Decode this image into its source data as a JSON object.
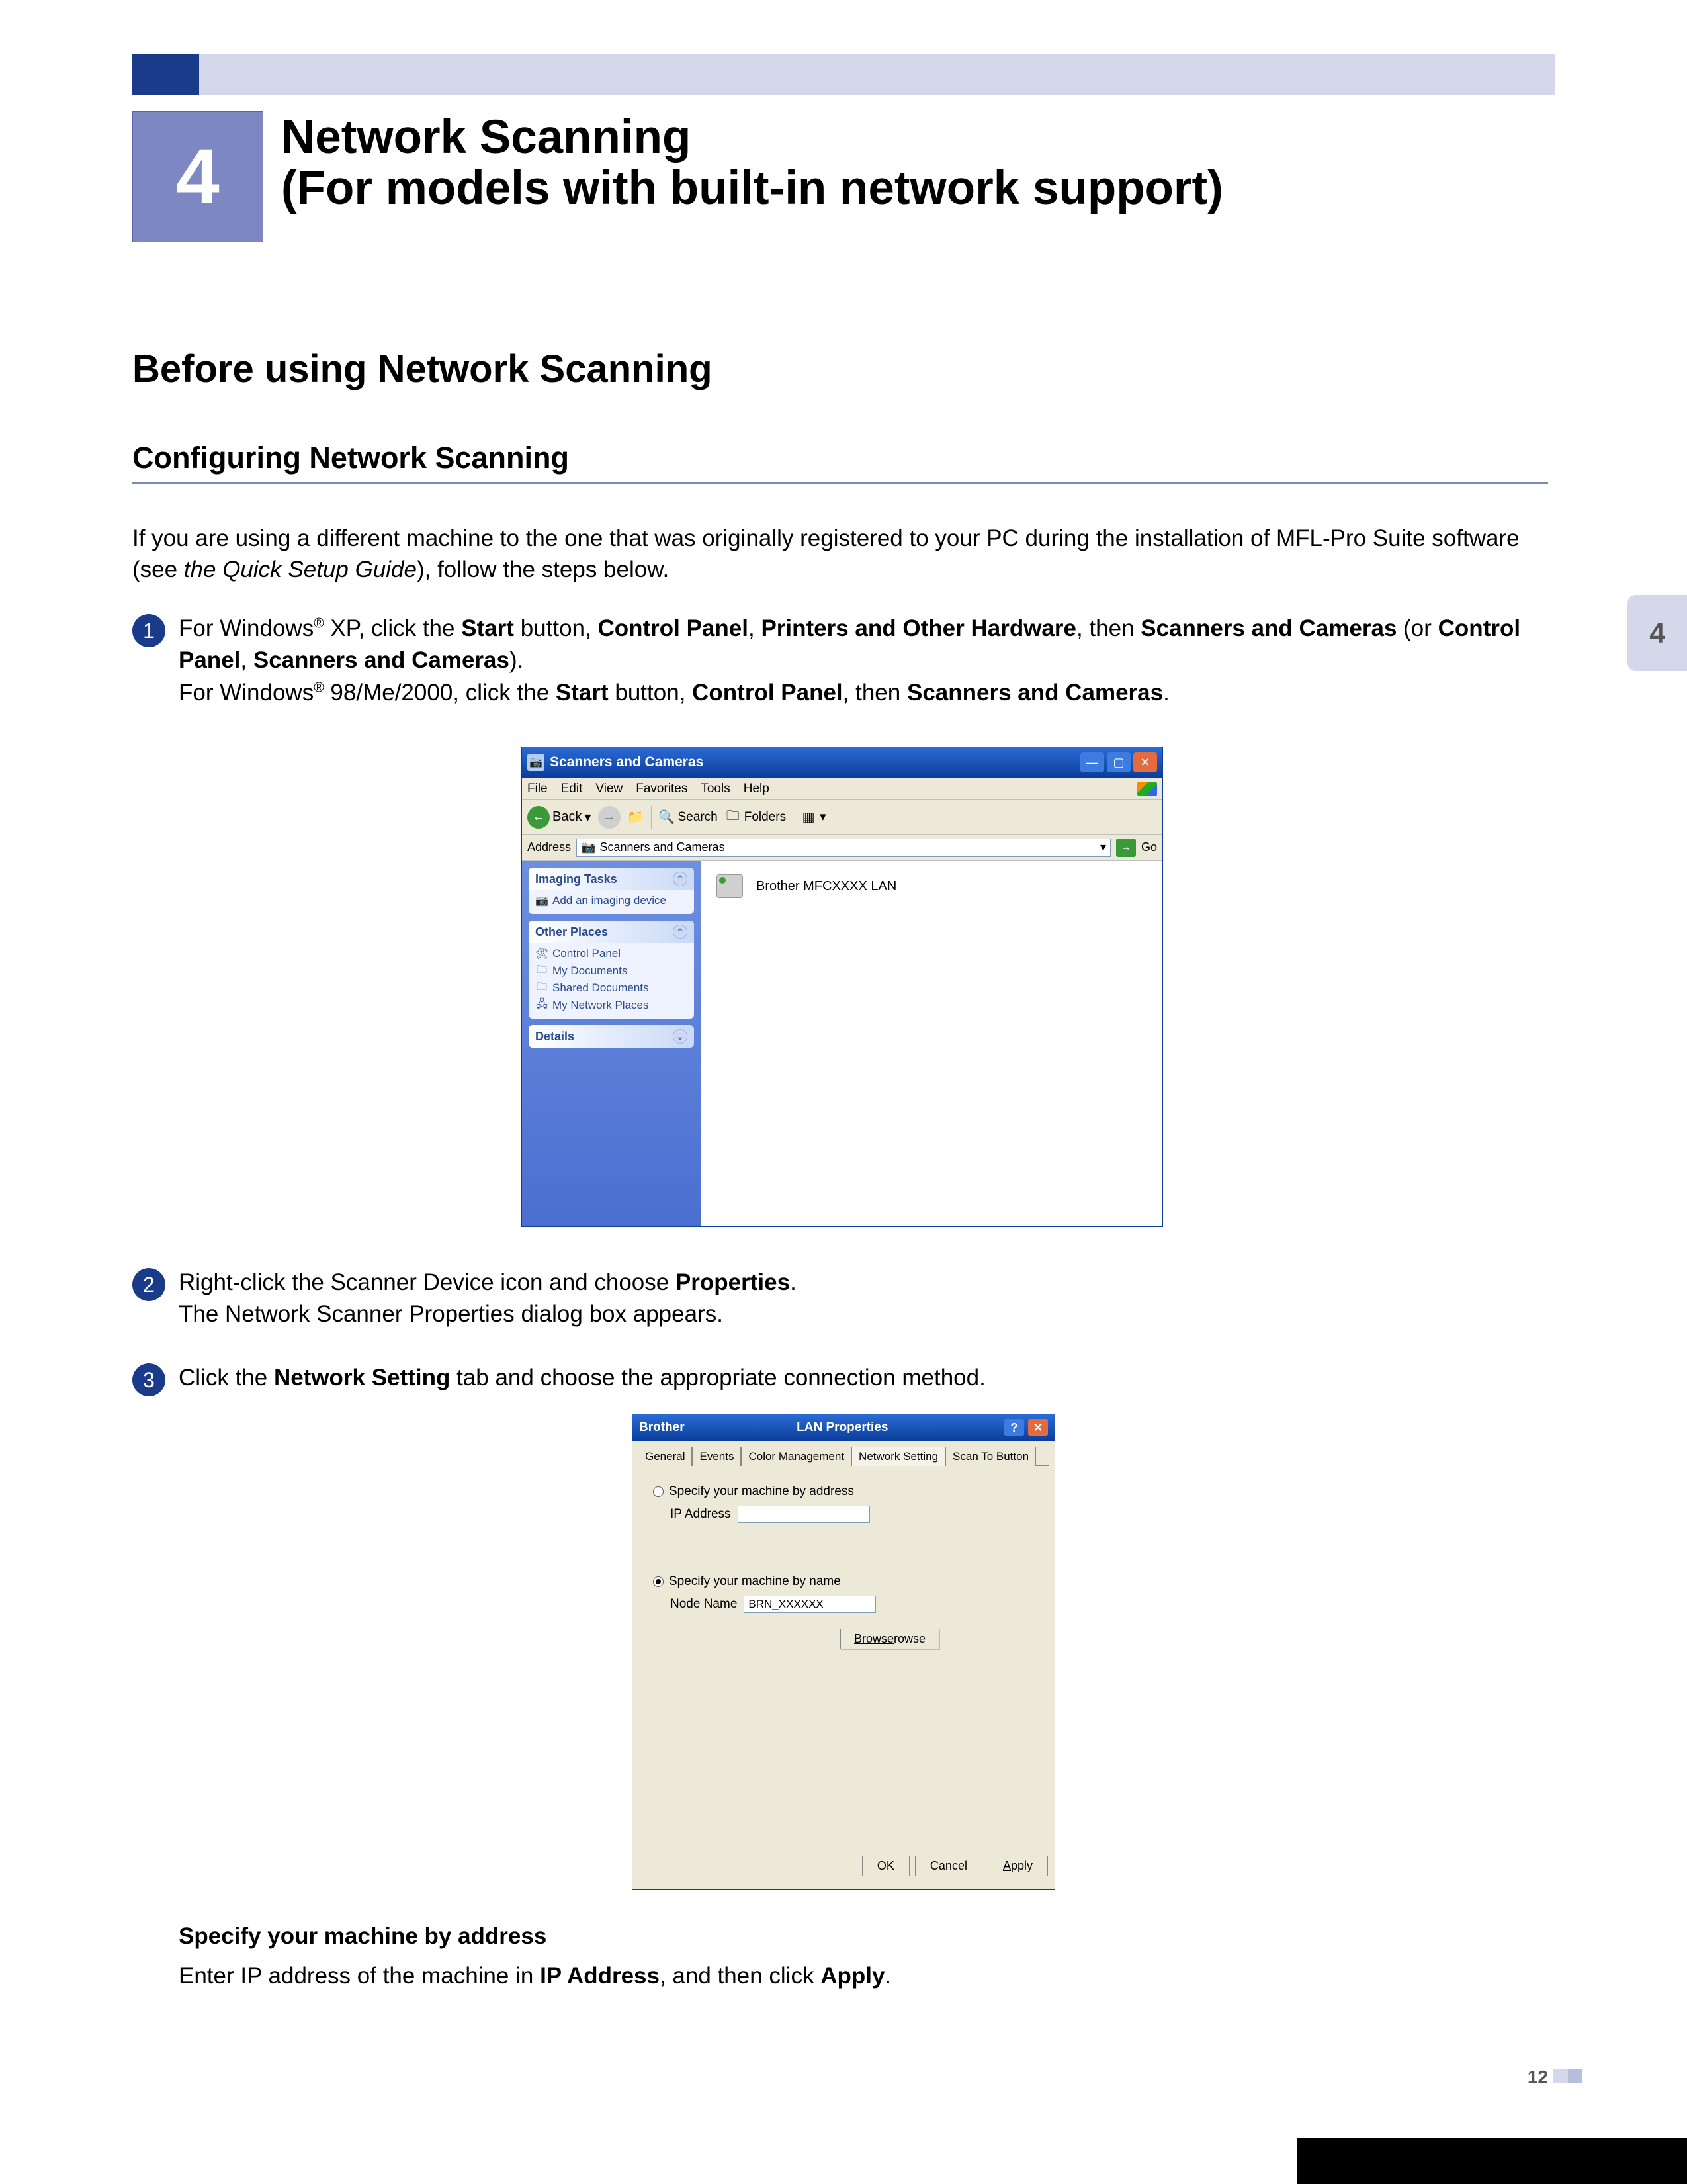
{
  "chapter": {
    "number": "4",
    "title_line1": "Network Scanning",
    "title_line2": "(For models with built-in network support)"
  },
  "side_tab": "4",
  "h1": "Before using Network Scanning",
  "h2": "Configuring Network Scanning",
  "intro_part1": "If you are using a different machine to the one that was originally registered to your PC during the installation of MFL-Pro Suite software (see ",
  "intro_italic": "the Quick Setup Guide",
  "intro_part2": "), follow the steps below.",
  "step1": {
    "num": "1",
    "a1": "For Windows",
    "a2": " XP, click the ",
    "b_start": "Start",
    "a3": " button, ",
    "b_cp": "Control Panel",
    "a4": ", ",
    "b_poh": "Printers and Other Hardware",
    "a5": ", then ",
    "b_sc": "Scanners and Cameras",
    "a6": " (or ",
    "b_cp2": "Control Panel",
    "a7": ", ",
    "b_sc2": "Scanners and Cameras",
    "a8": ").",
    "l2a": "For Windows",
    "l2b": " 98/Me/2000, click the ",
    "l2_start": "Start",
    "l2c": " button, ",
    "l2_cp": "Control Panel",
    "l2d": ", then ",
    "l2_sc": "Scanners and Cameras",
    "l2e": "."
  },
  "shot1": {
    "title": "Scanners and Cameras",
    "menu": {
      "file": "File",
      "edit": "Edit",
      "view": "View",
      "fav": "Favorites",
      "tools": "Tools",
      "help": "Help"
    },
    "toolbar": {
      "back": "Back",
      "search": "Search",
      "folders": "Folders"
    },
    "addr_label": "Address",
    "addr_value": "Scanners and Cameras",
    "go": "Go",
    "panel1": {
      "title": "Imaging Tasks",
      "link1": "Add an imaging device"
    },
    "panel2": {
      "title": "Other Places",
      "l1": "Control Panel",
      "l2": "My Documents",
      "l3": "Shared Documents",
      "l4": "My Network Places"
    },
    "panel3": {
      "title": "Details"
    },
    "device": "Brother MFCXXXX LAN"
  },
  "step2": {
    "num": "2",
    "t1": "Right-click the Scanner Device icon and choose ",
    "b_prop": "Properties",
    "t2": ".",
    "t3": "The Network Scanner Properties dialog box appears."
  },
  "step3": {
    "num": "3",
    "t1": "Click the ",
    "b_ns": "Network Setting",
    "t2": " tab and choose the appropriate connection method."
  },
  "shot2": {
    "title_left": "Brother",
    "title_mid": "LAN Properties",
    "tabs": {
      "general": "General",
      "events": "Events",
      "color": "Color Management",
      "net": "Network Setting",
      "scan": "Scan To Button"
    },
    "r1": "Specify your machine by address",
    "ip_label": "IP Address",
    "r2": "Specify your machine by name",
    "node_label": "Node Name",
    "node_value": "BRN_XXXXXX",
    "browse": "Browse",
    "ok": "OK",
    "cancel": "Cancel",
    "apply": "Apply"
  },
  "spec_heading": "Specify your machine by address",
  "spec": {
    "t1": "Enter IP address of the machine in ",
    "b_ip": "IP Address",
    "t2": ", and then click ",
    "b_apply": "Apply",
    "t3": "."
  },
  "page_number": "12"
}
